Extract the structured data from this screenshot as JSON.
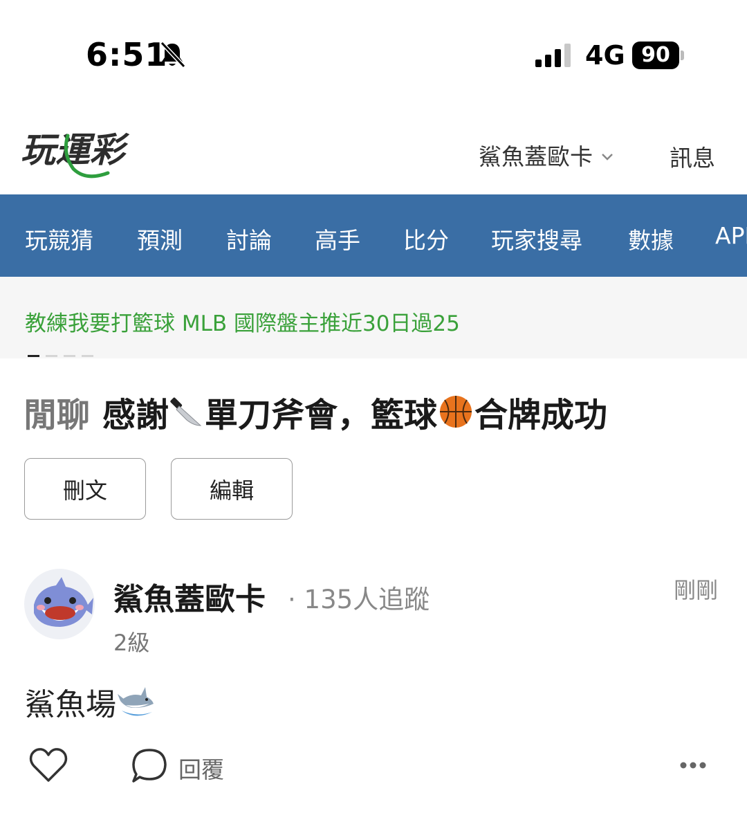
{
  "status_bar": {
    "time": "6:51",
    "network": "4G",
    "battery": "90"
  },
  "header": {
    "logo_text": "玩運彩",
    "user_menu_label": "鯊魚蓋歐卡",
    "messages_label": "訊息"
  },
  "nav": {
    "items": [
      "玩競猜",
      "預測",
      "討論",
      "高手",
      "比分",
      "玩家搜尋",
      "數據",
      "APP"
    ]
  },
  "ticker": {
    "text": "教練我要打籃球 MLB 國際盤主推近30日過25",
    "pages": 4,
    "active_page": 1
  },
  "post": {
    "category": "閒聊",
    "title_part1": "感謝",
    "title_part2": "單刀斧會，籃球",
    "title_part3": "合牌成功",
    "delete_label": "刪文",
    "edit_label": "編輯",
    "author_name": "鯊魚蓋歐卡",
    "followers": "· 135人追蹤",
    "level": "2級",
    "time": "剛剛",
    "body": "鯊魚場",
    "reply_label": "回覆"
  },
  "colors": {
    "nav_bg": "#3a6ea5",
    "ticker_text": "#3aa13a",
    "logo_green": "#2e9e3e"
  },
  "icons": [
    "bell-muted-icon",
    "signal-icon",
    "chevron-down-icon",
    "knife-icon",
    "basketball-icon",
    "shark-icon",
    "heart-icon",
    "comment-icon",
    "more-icon"
  ]
}
